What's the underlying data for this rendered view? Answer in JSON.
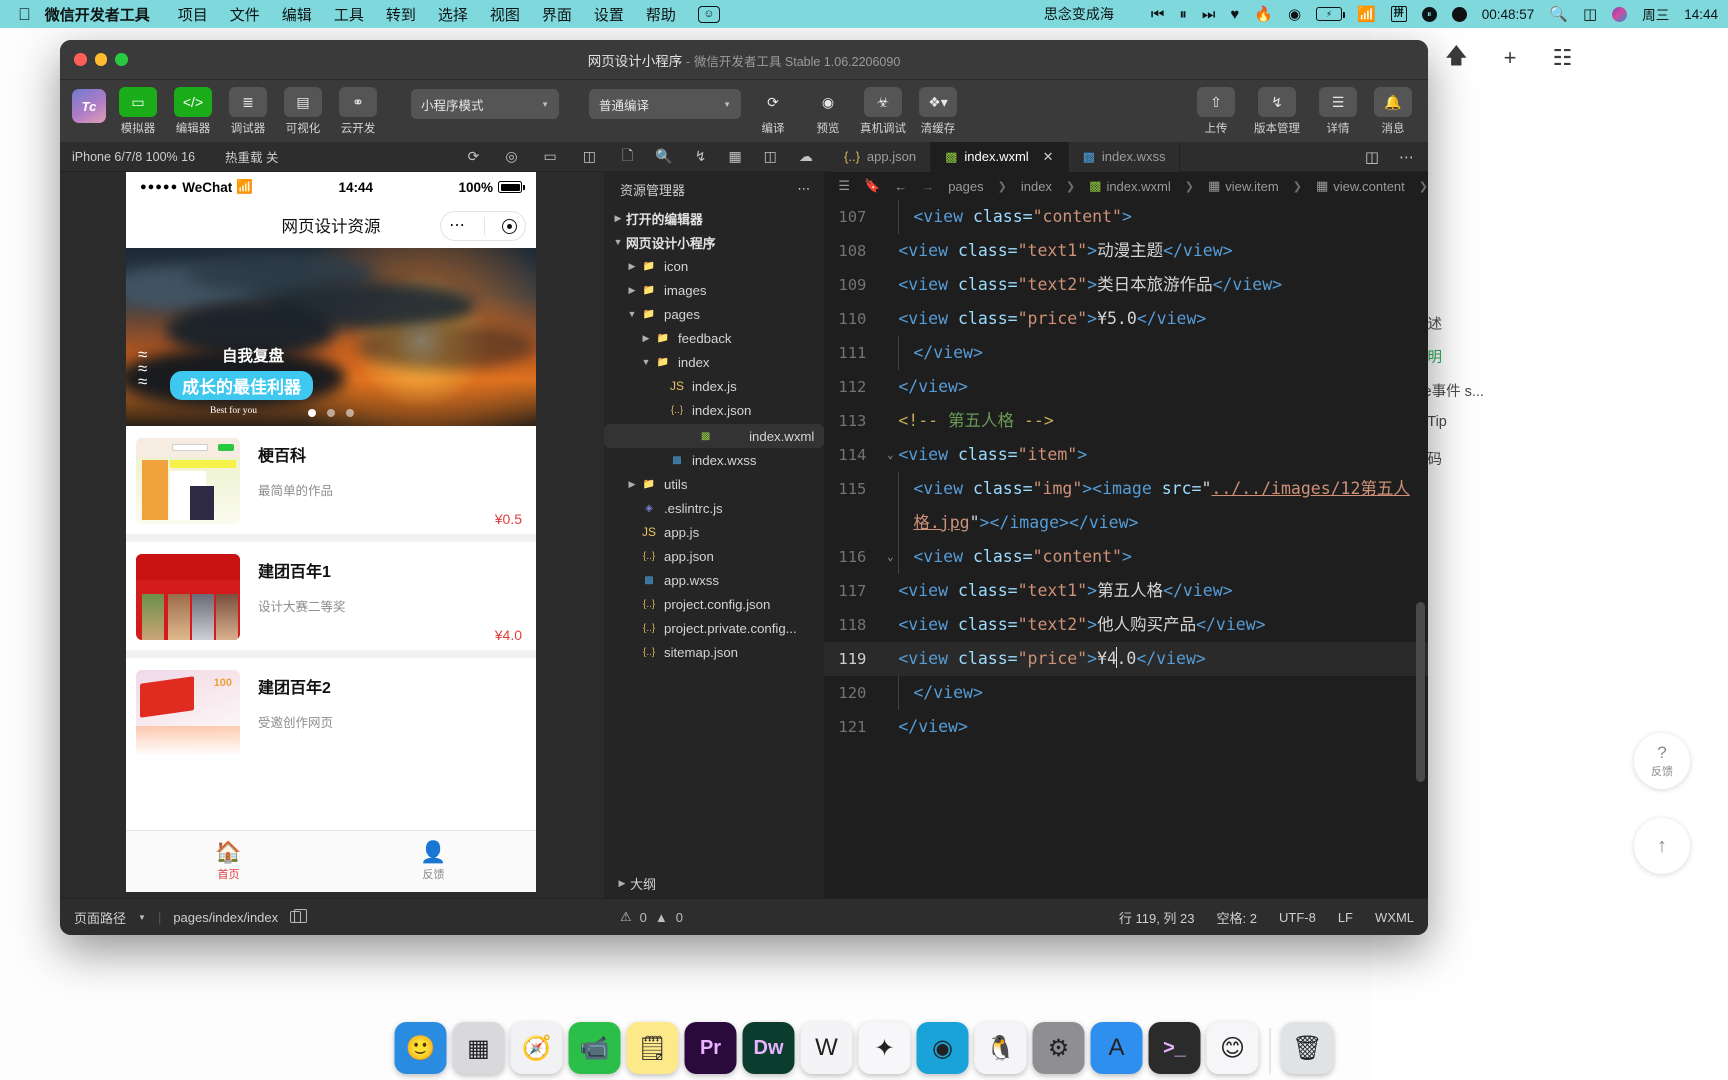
{
  "menubar": {
    "apple_icon": "apple-icon",
    "app_name": "微信开发者工具",
    "items": [
      "项目",
      "文件",
      "编辑",
      "工具",
      "转到",
      "选择",
      "视图",
      "界面",
      "设置",
      "帮助"
    ],
    "smiley_icon": "smiley-icon",
    "now_playing": "思念变成海",
    "media_prev_icon": "prev-track-icon",
    "media_pause_icon": "pause-icon",
    "media_next_icon": "next-track-icon",
    "heart_icon": "heart-icon",
    "flame_icon": "flame-icon",
    "play_circle_icon": "play-circle-icon",
    "battery_icon": "battery-charging-icon",
    "wifi_icon": "wifi-icon",
    "input_method": "拼",
    "pause_badge_icon": "pause-badge-icon",
    "record_badge_icon": "record-badge-icon",
    "timer": "00:48:57",
    "search_icon": "spotlight-search-icon",
    "control_center_icon": "control-center-icon",
    "siri_icon": "siri-icon",
    "day": "周三",
    "clock": "14:44"
  },
  "window": {
    "title": "网页设计小程序",
    "title_sep": "-",
    "subtitle": "微信开发者工具 Stable 1.06.2206090",
    "traffic": [
      "close-button",
      "minimize-button",
      "zoom-button"
    ]
  },
  "toolbar": {
    "logo_text": "Tc",
    "buttons": [
      {
        "label": "模拟器",
        "icon": "phone-icon",
        "active": true
      },
      {
        "label": "编辑器",
        "icon": "code-icon",
        "active": true
      },
      {
        "label": "调试器",
        "icon": "debugger-icon",
        "active": false
      },
      {
        "label": "可视化",
        "icon": "layout-icon",
        "active": false
      },
      {
        "label": "云开发",
        "icon": "cloud-icon",
        "active": false
      }
    ],
    "mode_select": "小程序模式",
    "compile_select": "普通编译",
    "actions": [
      {
        "label": "编译",
        "icon": "refresh-icon"
      },
      {
        "label": "预览",
        "icon": "eye-icon"
      },
      {
        "label": "真机调试",
        "icon": "bug-icon"
      },
      {
        "label": "清缓存",
        "icon": "layers-icon"
      }
    ],
    "right_actions": [
      {
        "label": "上传",
        "icon": "upload-icon"
      },
      {
        "label": "版本管理",
        "icon": "branch-icon"
      },
      {
        "label": "详情",
        "icon": "menu-icon"
      },
      {
        "label": "消息",
        "icon": "bell-icon"
      }
    ]
  },
  "subbar": {
    "device": "iPhone 6/7/8 100% 16",
    "hot_reload": "热重载 关",
    "sim_icons": [
      "refresh-icon",
      "record-icon",
      "device-rotate-icon",
      "split-icon"
    ],
    "explorer_icons": [
      "files-icon",
      "search-icon",
      "source-control-icon",
      "extensions-icon",
      "snippets-icon",
      "plugin-icon"
    ],
    "tabs": [
      {
        "label": "app.json",
        "icon": "json-file-icon",
        "active": false,
        "closable": false
      },
      {
        "label": "index.wxml",
        "icon": "wxml-file-icon",
        "active": true,
        "closable": true
      },
      {
        "label": "index.wxss",
        "icon": "wxss-file-icon",
        "active": false,
        "closable": false
      }
    ],
    "right_icons": [
      "split-editor-icon",
      "more-icon"
    ]
  },
  "simulator": {
    "status": {
      "carrier": "WeChat",
      "signal_dots": "●●●●●",
      "wifi_icon": "wifi-icon",
      "time": "14:44",
      "battery": "100%"
    },
    "nav_title": "网页设计资源",
    "capsule": {
      "more_icon": "more-dots-icon",
      "target_icon": "target-circle-icon"
    },
    "banner": {
      "wave_icon": "wave-icon",
      "line1": "自我复盘",
      "line2": "成长的最佳利器",
      "line3": "Best for you",
      "dots": 3,
      "active_dot": 0
    },
    "items": [
      {
        "title": "梗百科",
        "desc": "最简单的作品",
        "price": "¥0.5"
      },
      {
        "title": "建团百年1",
        "desc": "设计大赛二等奖",
        "price": "¥4.0"
      },
      {
        "title": "建团百年2",
        "desc": "受邀创作网页",
        "price": ""
      }
    ],
    "tabbar": [
      {
        "label": "首页",
        "icon": "home-icon",
        "active": true
      },
      {
        "label": "反馈",
        "icon": "user-icon",
        "active": false
      }
    ]
  },
  "explorer": {
    "title": "资源管理器",
    "more_icon": "more-dots-icon",
    "sections": [
      {
        "label": "打开的编辑器",
        "expanded": false
      },
      {
        "label": "网页设计小程序",
        "expanded": true
      }
    ],
    "tree": [
      {
        "label": "icon",
        "type": "folder-teal",
        "depth": 1,
        "arrow": "▶"
      },
      {
        "label": "images",
        "type": "folder-teal",
        "depth": 1,
        "arrow": "▶"
      },
      {
        "label": "pages",
        "type": "folder-orange",
        "depth": 1,
        "arrow": "▼"
      },
      {
        "label": "feedback",
        "type": "folder-blue",
        "depth": 2,
        "arrow": "▶"
      },
      {
        "label": "index",
        "type": "folder-blue",
        "depth": 2,
        "arrow": "▼"
      },
      {
        "label": "index.js",
        "type": "js",
        "depth": 3,
        "arrow": ""
      },
      {
        "label": "index.json",
        "type": "json",
        "depth": 3,
        "arrow": ""
      },
      {
        "label": "index.wxml",
        "type": "wxml",
        "depth": 3,
        "arrow": "",
        "selected": true
      },
      {
        "label": "index.wxss",
        "type": "wxss",
        "depth": 3,
        "arrow": ""
      },
      {
        "label": "utils",
        "type": "folder-green",
        "depth": 1,
        "arrow": "▶"
      },
      {
        "label": ".eslintrc.js",
        "type": "eslint",
        "depth": 1,
        "arrow": ""
      },
      {
        "label": "app.js",
        "type": "js",
        "depth": 1,
        "arrow": ""
      },
      {
        "label": "app.json",
        "type": "json",
        "depth": 1,
        "arrow": ""
      },
      {
        "label": "app.wxss",
        "type": "wxss",
        "depth": 1,
        "arrow": ""
      },
      {
        "label": "project.config.json",
        "type": "json",
        "depth": 1,
        "arrow": ""
      },
      {
        "label": "project.private.config...",
        "type": "json",
        "depth": 1,
        "arrow": ""
      },
      {
        "label": "sitemap.json",
        "type": "json",
        "depth": 1,
        "arrow": ""
      }
    ],
    "outline": "大纲"
  },
  "editor": {
    "breadcrumb": [
      "pages",
      "index",
      "index.wxml",
      "view.item",
      "view.content"
    ],
    "breadcrumb_icons": [
      "list-icon",
      "bookmark-icon",
      "arrow-left-icon",
      "arrow-right-icon"
    ],
    "lines": [
      {
        "n": "107",
        "indent": true,
        "parts": [
          {
            "t": "tag",
            "v": "<view "
          },
          {
            "t": "attr",
            "v": "class="
          },
          {
            "t": "val",
            "v": "\"content\""
          },
          {
            "t": "tag",
            "v": ">"
          }
        ]
      },
      {
        "n": "108",
        "indent": false,
        "parts": [
          {
            "t": "tag",
            "v": "<view "
          },
          {
            "t": "attr",
            "v": "class="
          },
          {
            "t": "val",
            "v": "\"text1\""
          },
          {
            "t": "tag",
            "v": ">"
          },
          {
            "t": "txt",
            "v": "动漫主题"
          },
          {
            "t": "tag",
            "v": "</view>"
          }
        ]
      },
      {
        "n": "109",
        "indent": false,
        "parts": [
          {
            "t": "tag",
            "v": "<view "
          },
          {
            "t": "attr",
            "v": "class="
          },
          {
            "t": "val",
            "v": "\"text2\""
          },
          {
            "t": "tag",
            "v": ">"
          },
          {
            "t": "txt",
            "v": "类日本旅游作品"
          },
          {
            "t": "tag",
            "v": "</view>"
          }
        ]
      },
      {
        "n": "110",
        "indent": false,
        "parts": [
          {
            "t": "tag",
            "v": "<view "
          },
          {
            "t": "attr",
            "v": "class="
          },
          {
            "t": "val",
            "v": "\"price\""
          },
          {
            "t": "tag",
            "v": ">"
          },
          {
            "t": "txt",
            "v": "¥5.0"
          },
          {
            "t": "tag",
            "v": "</view>"
          }
        ]
      },
      {
        "n": "111",
        "indent": true,
        "parts": [
          {
            "t": "tag",
            "v": "</view>"
          }
        ]
      },
      {
        "n": "112",
        "indent": false,
        "parts": [
          {
            "t": "tag",
            "v": "</view>"
          }
        ]
      },
      {
        "n": "113",
        "indent": false,
        "parts": [
          {
            "t": "cmtm",
            "v": "<!-- "
          },
          {
            "t": "cmt",
            "v": "第五人格"
          },
          {
            "t": "cmtm",
            "v": " -->"
          }
        ]
      },
      {
        "n": "114",
        "indent": false,
        "fold": "⌄",
        "parts": [
          {
            "t": "tag",
            "v": "<view "
          },
          {
            "t": "attr",
            "v": "class="
          },
          {
            "t": "val",
            "v": "\"item\""
          },
          {
            "t": "tag",
            "v": ">"
          }
        ]
      },
      {
        "n": "115",
        "indent": true,
        "parts": [
          {
            "t": "tag",
            "v": "<view "
          },
          {
            "t": "attr",
            "v": "class="
          },
          {
            "t": "val",
            "v": "\"img\""
          },
          {
            "t": "tag",
            "v": "><image "
          },
          {
            "t": "attr",
            "v": "src="
          },
          {
            "t": "punc",
            "v": "\""
          },
          {
            "t": "lnk",
            "v": "../../images/12第五人格.jpg"
          },
          {
            "t": "punc",
            "v": "\""
          },
          {
            "t": "tag",
            "v": "></image></view>"
          }
        ]
      },
      {
        "n": "116",
        "indent": true,
        "fold": "⌄",
        "parts": [
          {
            "t": "tag",
            "v": "<view "
          },
          {
            "t": "attr",
            "v": "class="
          },
          {
            "t": "val",
            "v": "\"content\""
          },
          {
            "t": "tag",
            "v": ">"
          }
        ]
      },
      {
        "n": "117",
        "indent": false,
        "parts": [
          {
            "t": "tag",
            "v": "<view "
          },
          {
            "t": "attr",
            "v": "class="
          },
          {
            "t": "val",
            "v": "\"text1\""
          },
          {
            "t": "tag",
            "v": ">"
          },
          {
            "t": "txt",
            "v": "第五人格"
          },
          {
            "t": "tag",
            "v": "</view>"
          }
        ]
      },
      {
        "n": "118",
        "indent": false,
        "parts": [
          {
            "t": "tag",
            "v": "<view "
          },
          {
            "t": "attr",
            "v": "class="
          },
          {
            "t": "val",
            "v": "\"text2\""
          },
          {
            "t": "tag",
            "v": ">"
          },
          {
            "t": "txt",
            "v": "他人购买产品"
          },
          {
            "t": "tag",
            "v": "</view>"
          }
        ]
      },
      {
        "n": "119",
        "indent": false,
        "current": true,
        "parts": [
          {
            "t": "tag",
            "v": "<view "
          },
          {
            "t": "attr",
            "v": "class="
          },
          {
            "t": "val",
            "v": "\"price\""
          },
          {
            "t": "tag",
            "v": ">"
          },
          {
            "t": "txt",
            "v": "¥4"
          },
          {
            "t": "caret",
            "v": ""
          },
          {
            "t": "txt",
            "v": ".0"
          },
          {
            "t": "tag",
            "v": "</view>"
          }
        ]
      },
      {
        "n": "120",
        "indent": true,
        "parts": [
          {
            "t": "tag",
            "v": "</view>"
          }
        ]
      },
      {
        "n": "121",
        "indent": false,
        "parts": [
          {
            "t": "tag",
            "v": "</view>"
          }
        ]
      }
    ]
  },
  "statusfoot": {
    "page_path_label": "页面路径",
    "page_path": "pages/index/index",
    "copy_icon": "copy-icon",
    "diagnostics_error_icon": "error-icon",
    "errors": "0",
    "warnings_icon": "warning-icon",
    "warnings": "0",
    "cursor": "行 119, 列 23",
    "spaces": "空格: 2",
    "encoding": "UTF-8",
    "eol": "LF",
    "language": "WXML"
  },
  "background_page": {
    "lines": [
      "功能描述",
      "属性说明",
      "change事件 s...",
      "Bug & Tip",
      "示例代码"
    ],
    "feedback_label": "反馈",
    "feedback_icon": "question-icon",
    "scroll_top_icon": "arrow-up-icon"
  },
  "dock": {
    "items": [
      {
        "name": "finder-icon",
        "glyph": "🙂",
        "bg": "#2a8ce0"
      },
      {
        "name": "launchpad-icon",
        "glyph": "▦",
        "bg": "#d9d9dd"
      },
      {
        "name": "safari-icon",
        "glyph": "🧭",
        "bg": "#f2f2f4"
      },
      {
        "name": "facetime-icon",
        "glyph": "📹",
        "bg": "#2bbf4a"
      },
      {
        "name": "notes-icon",
        "glyph": "🗒",
        "bg": "#fde88a"
      },
      {
        "name": "premiere-icon",
        "glyph": "Pr",
        "bg": "#2a0a3c"
      },
      {
        "name": "dreamweaver-icon",
        "glyph": "Dw",
        "bg": "#0b3d2e"
      },
      {
        "name": "word-icon",
        "glyph": "W",
        "bg": "#f4f4f6"
      },
      {
        "name": "colorful-app-icon",
        "glyph": "✦",
        "bg": "#f7f7f9"
      },
      {
        "name": "kugou-icon",
        "glyph": "◉",
        "bg": "#1aa3d8"
      },
      {
        "name": "qq-icon",
        "glyph": "🐧",
        "bg": "#f5f5f7"
      },
      {
        "name": "settings-icon",
        "glyph": "⚙",
        "bg": "#8e8e93"
      },
      {
        "name": "appstore-icon",
        "glyph": "A",
        "bg": "#2f8fef"
      },
      {
        "name": "terminal-icon",
        "glyph": ">_",
        "bg": "#2b2b2b"
      },
      {
        "name": "emoji-app-icon",
        "glyph": "😊",
        "bg": "#f6f6f8"
      },
      {
        "name": "trash-icon",
        "glyph": "🗑",
        "bg": "#dfe3e6"
      }
    ]
  }
}
